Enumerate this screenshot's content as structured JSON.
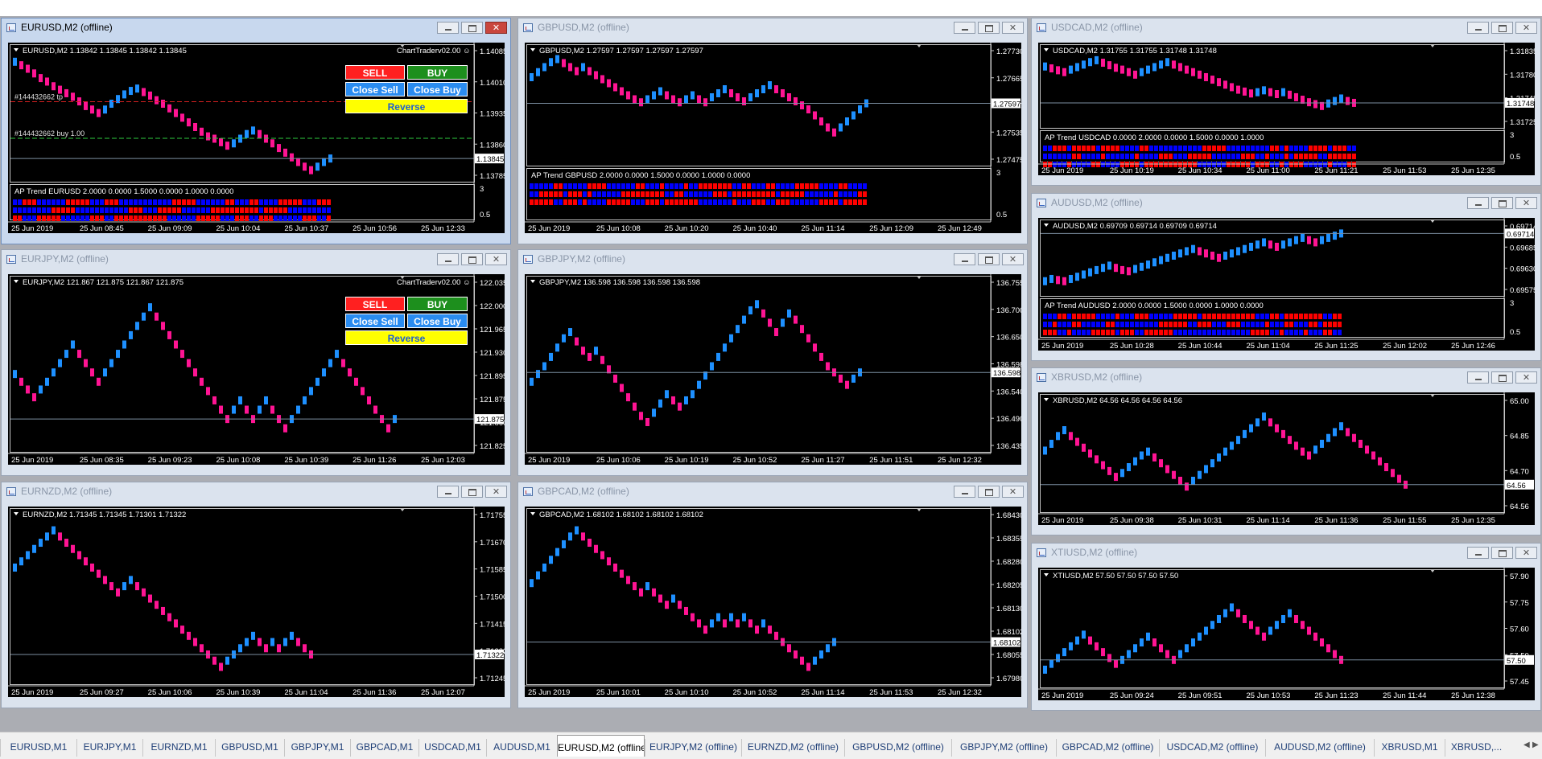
{
  "colors": {
    "up": "#1e90ff",
    "down": "#ff1493",
    "chart_bg": "#000000",
    "trend_up": "#0000ff",
    "trend_down": "#ff0000"
  },
  "windows": [
    {
      "id": "eurusd",
      "title": "EURUSD,M2 (offline)",
      "active": true,
      "info": "EURUSD,M2  1.13842 1.13845 1.13842 1.13845",
      "trader_label": "ChartTraderv02.00 ☺",
      "prices": [
        "1.14085",
        "1.14010",
        "1.13935",
        "1.13860",
        "1.13785"
      ],
      "current_price": "1.13845",
      "times": [
        "25 Jun 2019",
        "25 Jun 08:45",
        "25 Jun 09:09",
        "25 Jun 10:04",
        "25 Jun 10:37",
        "25 Jun 10:56",
        "25 Jun 12:33"
      ],
      "order_lines": [
        "#144432662 tp",
        "#144432662 buy 1.00"
      ],
      "indicator": {
        "label": "AP Trend EURUSD 2.0000 0.0000 1.5000 0.0000 1.0000 0.0000",
        "scale": [
          "3",
          "0.5"
        ]
      },
      "trader": {
        "sell": "SELL",
        "buy": "BUY",
        "close_sell": "Close Sell",
        "close_buy": "Close Buy",
        "reverse": "Reverse"
      }
    },
    {
      "id": "gbpusd",
      "title": "GBPUSD,M2 (offline)",
      "info": "GBPUSD,M2  1.27597 1.27597 1.27597 1.27597",
      "prices": [
        "1.27730",
        "1.27665",
        "1.27597",
        "1.27535",
        "1.27475"
      ],
      "current_price": "1.27597",
      "times": [
        "25 Jun 2019",
        "25 Jun 10:08",
        "25 Jun 10:20",
        "25 Jun 10:40",
        "25 Jun 11:14",
        "25 Jun 12:09",
        "25 Jun 12:49"
      ],
      "indicator": {
        "label": "AP Trend GBPUSD 2.0000 0.0000 1.5000 0.0000 1.0000 0.0000",
        "scale": [
          "3",
          "0.5"
        ]
      }
    },
    {
      "id": "usdcad",
      "title": "USDCAD,M2 (offline)",
      "info": "USDCAD,M2  1.31755 1.31755 1.31748 1.31748",
      "prices": [
        "1.31835",
        "1.31780",
        "1.31748",
        "1.31725"
      ],
      "current_price": "1.31748",
      "times": [
        "25 Jun 2019",
        "25 Jun 10:19",
        "25 Jun 10:34",
        "25 Jun 11:00",
        "25 Jun 11:21",
        "25 Jun 11:53",
        "25 Jun 12:35"
      ],
      "indicator": {
        "label": "AP Trend USDCAD 0.0000 2.0000 0.0000 1.5000 0.0000 1.0000",
        "scale": [
          "3",
          "0.5"
        ]
      }
    },
    {
      "id": "eurjpy",
      "title": "EURJPY,M2 (offline)",
      "info": "EURJPY,M2  121.867 121.875 121.867 121.875",
      "trader_label": "ChartTraderv02.00 ☺",
      "prices": [
        "122.035",
        "122.000",
        "121.965",
        "121.930",
        "121.895",
        "121.875",
        "121.860",
        "121.825"
      ],
      "current_price": "121.875",
      "times": [
        "25 Jun 2019",
        "25 Jun 08:35",
        "25 Jun 09:23",
        "25 Jun 10:08",
        "25 Jun 10:39",
        "25 Jun 11:26",
        "25 Jun 12:03"
      ],
      "trader": {
        "sell": "SELL",
        "buy": "BUY",
        "close_sell": "Close Sell",
        "close_buy": "Close Buy",
        "reverse": "Reverse"
      }
    },
    {
      "id": "gbpjpy",
      "title": "GBPJPY,M2 (offline)",
      "info": "GBPJPY,M2  136.598 136.598 136.598 136.598",
      "prices": [
        "136.755",
        "136.700",
        "136.650",
        "136.598",
        "136.540",
        "136.490",
        "136.435"
      ],
      "current_price": "136.598",
      "times": [
        "25 Jun 2019",
        "25 Jun 10:06",
        "25 Jun 10:19",
        "25 Jun 10:52",
        "25 Jun 11:27",
        "25 Jun 11:51",
        "25 Jun 12:32"
      ]
    },
    {
      "id": "audusd",
      "title": "AUDUSD,M2 (offline)",
      "info": "AUDUSD,M2  0.69709 0.69714 0.69709 0.69714",
      "prices": [
        "0.69714",
        "0.69685",
        "0.69630",
        "0.69575"
      ],
      "current_price": "0.69714",
      "times": [
        "25 Jun 2019",
        "25 Jun 10:28",
        "25 Jun 10:44",
        "25 Jun 11:04",
        "25 Jun 11:25",
        "25 Jun 12:02",
        "25 Jun 12:46"
      ],
      "indicator": {
        "label": "AP Trend AUDUSD 2.0000 0.0000 1.5000 0.0000 1.0000 0.0000",
        "scale": [
          "3",
          "0.5"
        ]
      }
    },
    {
      "id": "xbrusd",
      "title": "XBRUSD,M2 (offline)",
      "info": "XBRUSD,M2  64.56 64.56 64.56 64.56",
      "prices": [
        "65.00",
        "64.85",
        "64.70",
        "64.56"
      ],
      "current_price": "64.56",
      "times": [
        "25 Jun 2019",
        "25 Jun 09:38",
        "25 Jun 10:31",
        "25 Jun 11:14",
        "25 Jun 11:36",
        "25 Jun 11:55",
        "25 Jun 12:35"
      ]
    },
    {
      "id": "eurnzd",
      "title": "EURNZD,M2 (offline)",
      "info": "EURNZD,M2  1.71345 1.71345 1.71301 1.71322",
      "prices": [
        "1.71755",
        "1.71670",
        "1.71585",
        "1.71500",
        "1.71415",
        "1.71322",
        "1.71245"
      ],
      "current_price": "1.71322",
      "times": [
        "25 Jun 2019",
        "25 Jun 09:27",
        "25 Jun 10:06",
        "25 Jun 10:39",
        "25 Jun 11:04",
        "25 Jun 11:36",
        "25 Jun 12:07"
      ]
    },
    {
      "id": "gbpcad",
      "title": "GBPCAD,M2 (offline)",
      "info": "GBPCAD,M2  1.68102 1.68102 1.68102 1.68102",
      "prices": [
        "1.68430",
        "1.68355",
        "1.68280",
        "1.68205",
        "1.68130",
        "1.68102",
        "1.68055",
        "1.67980"
      ],
      "current_price": "1.68102",
      "times": [
        "25 Jun 2019",
        "25 Jun 10:01",
        "25 Jun 10:10",
        "25 Jun 10:52",
        "25 Jun 11:14",
        "25 Jun 11:53",
        "25 Jun 12:32"
      ]
    },
    {
      "id": "xtiusd",
      "title": "XTIUSD,M2 (offline)",
      "info": "XTIUSD,M2  57.50 57.50 57.50 57.50",
      "prices": [
        "57.90",
        "57.75",
        "57.60",
        "57.50",
        "57.45"
      ],
      "current_price": "57.50",
      "times": [
        "25 Jun 2019",
        "25 Jun 09:24",
        "25 Jun 09:51",
        "25 Jun 10:53",
        "25 Jun 11:23",
        "25 Jun 11:44",
        "25 Jun 12:38"
      ]
    }
  ],
  "tabs": [
    "EURUSD,M1",
    "EURJPY,M1",
    "EURNZD,M1",
    "GBPUSD,M1",
    "GBPJPY,M1",
    "GBPCAD,M1",
    "USDCAD,M1",
    "AUDUSD,M1",
    "EURUSD,M2 (offline)",
    "EURJPY,M2 (offline)",
    "EURNZD,M2 (offline)",
    "GBPUSD,M2 (offline)",
    "GBPJPY,M2 (offline)",
    "GBPCAD,M2 (offline)",
    "USDCAD,M2 (offline)",
    "AUDUSD,M2 (offline)",
    "XBRUSD,M1",
    "XBRUSD,..."
  ],
  "active_tab": 8
}
